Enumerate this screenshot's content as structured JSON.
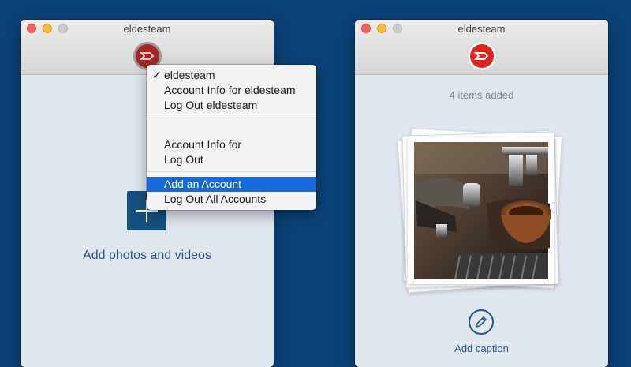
{
  "left_window": {
    "title": "eldesteam",
    "add_media_label": "Add photos and videos"
  },
  "account_menu": {
    "current_account": "eldesteam",
    "account_info": "Account Info for eldesteam",
    "log_out": "Log Out eldesteam",
    "account_info_generic": "Account Info for",
    "log_out_generic": "Log Out",
    "add_account": "Add an Account",
    "log_out_all": "Log Out All Accounts"
  },
  "right_window": {
    "title": "eldesteam",
    "items_added": "4 items added",
    "caption_label": "Add caption"
  },
  "colors": {
    "desktop": "#0b4379",
    "accent": "#1f5890",
    "menu_highlight": "#1869d9",
    "avatar_red": "#e3211f"
  },
  "icons": [
    "plus-icon",
    "pencil-icon",
    "checkmark-icon",
    "account-avatar-icon"
  ]
}
